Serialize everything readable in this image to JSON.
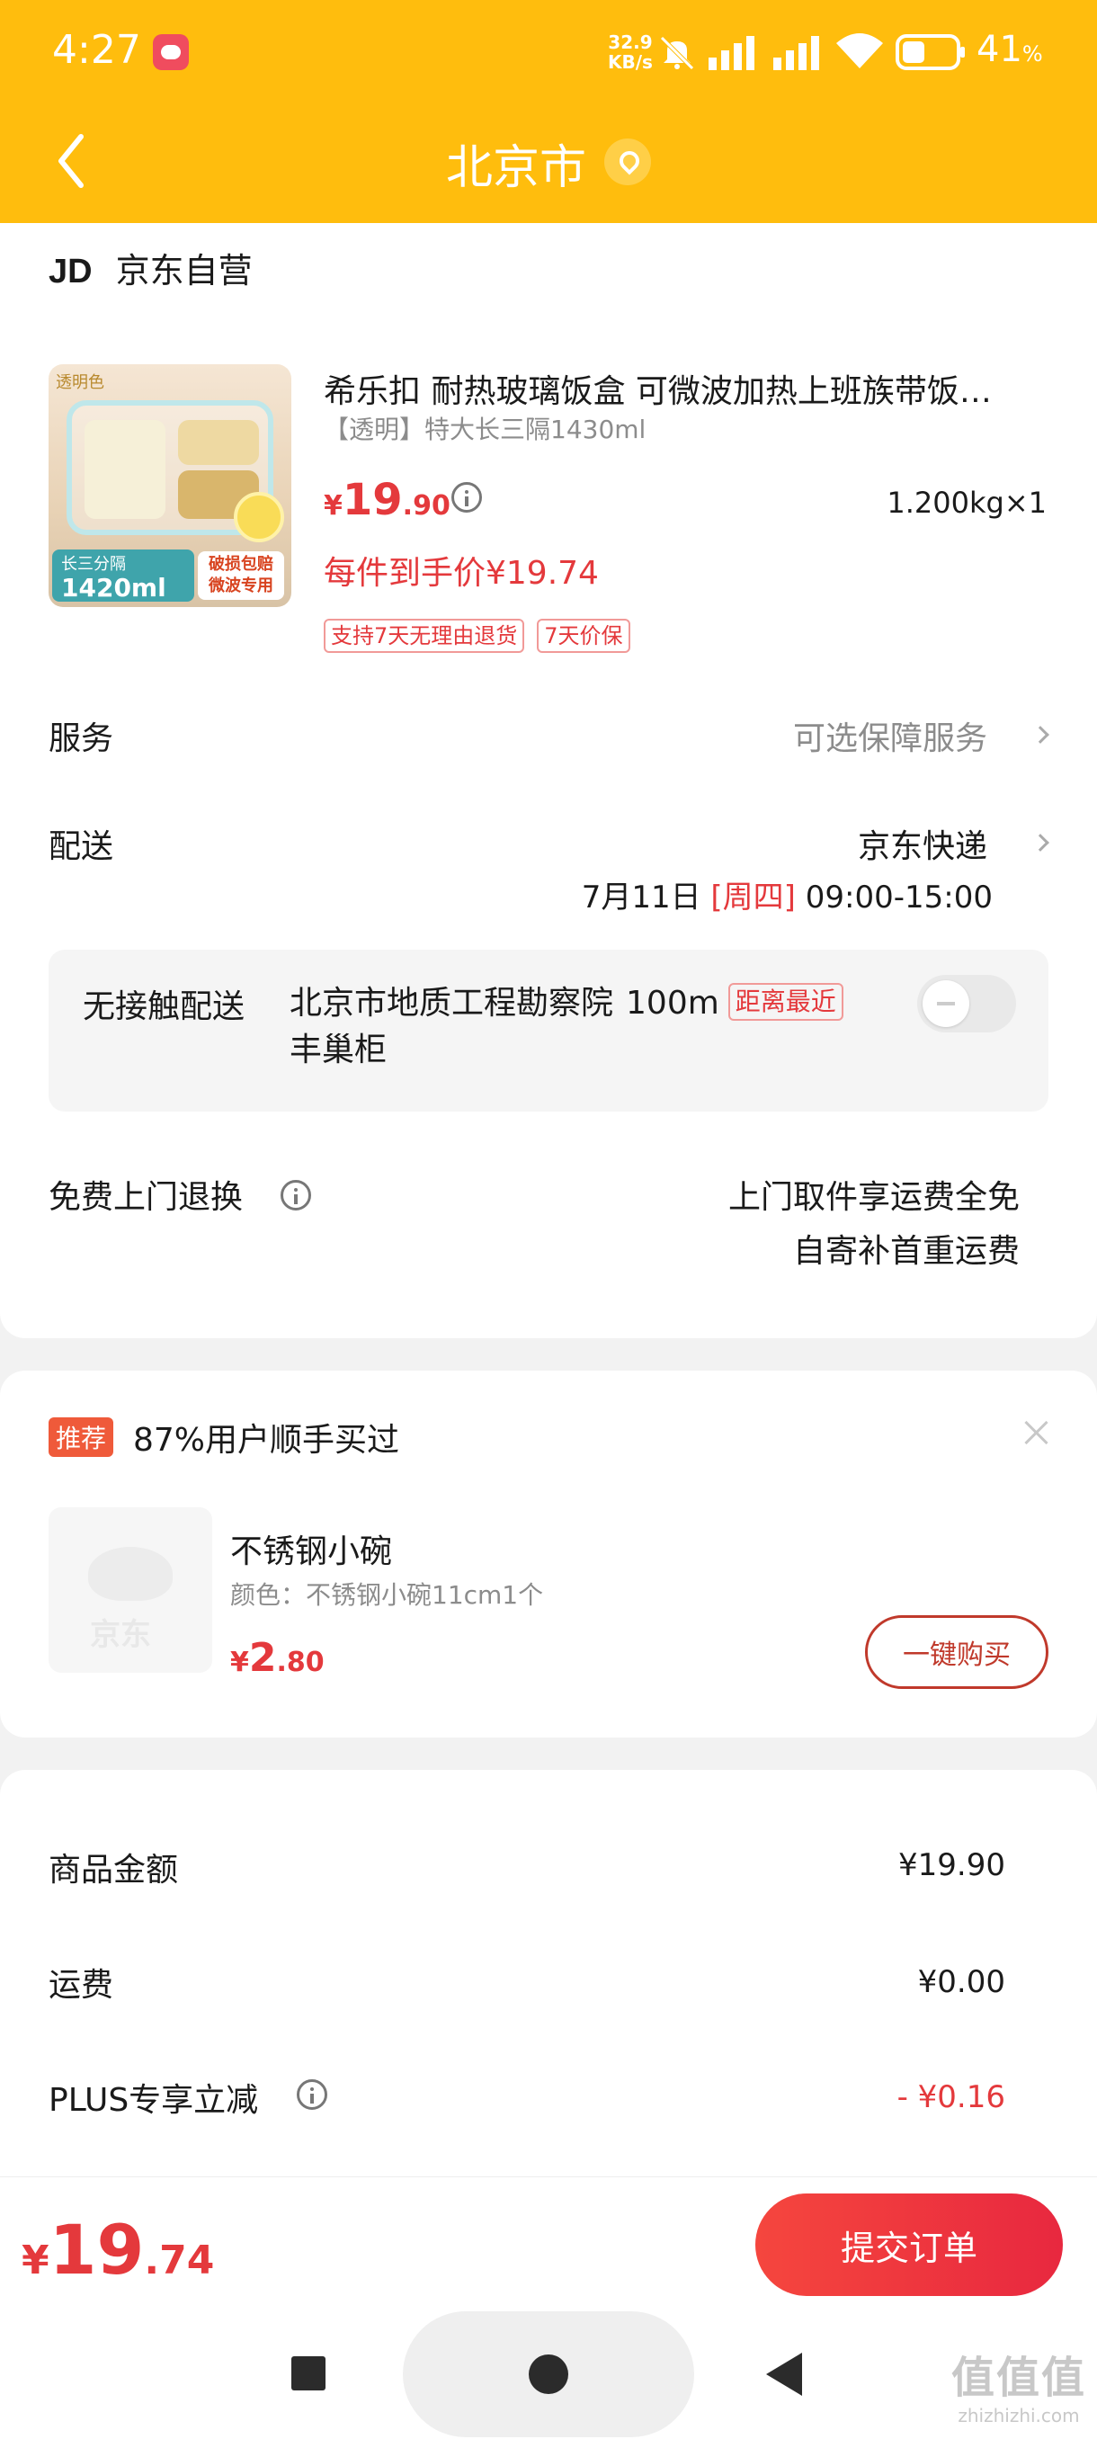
{
  "status_bar": {
    "time": "4:27",
    "net_speed_value": "32.9",
    "net_speed_unit": "KB/s",
    "battery_value": "41",
    "battery_unit": "%"
  },
  "nav": {
    "title": "北京市"
  },
  "shop": {
    "logo": "JD",
    "name": "京东自营"
  },
  "product": {
    "image_tag": "透明色",
    "image_badge_line1": "长三分隔",
    "image_badge_line2": "1420ml",
    "image_badge_right": "破损包赔 微波专用",
    "title": "希乐扣 耐热玻璃饭盒 可微波加热上班族带饭…",
    "spec": "【透明】特大长三隔1430ml",
    "price_symbol": "¥",
    "price_int": "19",
    "price_dec": ".90",
    "weight": "1.200kg×1",
    "final_price": "每件到手价¥19.74",
    "tags": [
      "支持7天无理由退货",
      "7天价保"
    ]
  },
  "service": {
    "label": "服务",
    "value": "可选保障服务"
  },
  "delivery": {
    "label": "配送",
    "carrier": "京东快递",
    "date": "7月11日",
    "weekday": "[周四]",
    "time_range": "09:00-15:00"
  },
  "contactless": {
    "label": "无接触配送",
    "address": "北京市地质工程勘察院",
    "distance": "100m",
    "badge": "距离最近",
    "locker": "丰巢柜"
  },
  "returns": {
    "label": "免费上门退换",
    "line1": "上门取件享运费全免",
    "line2": "自寄补首重运费"
  },
  "recommend": {
    "badge": "推荐",
    "title": "87%用户顺手买过",
    "image_text": "京东",
    "item_name": "不锈钢小碗",
    "item_spec": "颜色：不锈钢小碗11cm1个",
    "price_symbol": "¥",
    "price_int": "2",
    "price_dec": ".80",
    "buy_label": "一键购买"
  },
  "summary": {
    "rows": [
      {
        "label": "商品金额",
        "value": "¥19.90"
      },
      {
        "label": "运费",
        "value": "¥0.00"
      },
      {
        "label": "PLUS专享立减",
        "value": "- ¥0.16"
      }
    ]
  },
  "footer": {
    "total_symbol": "¥",
    "total_int": "19",
    "total_dec": ".74",
    "submit_label": "提交订单"
  },
  "watermark": {
    "line1": "值值值",
    "line2": "zhizhizhi.com"
  },
  "colors": {
    "header": "#ffbd0d",
    "accent_red": "#e4393c",
    "button_red": "#f5463e"
  }
}
